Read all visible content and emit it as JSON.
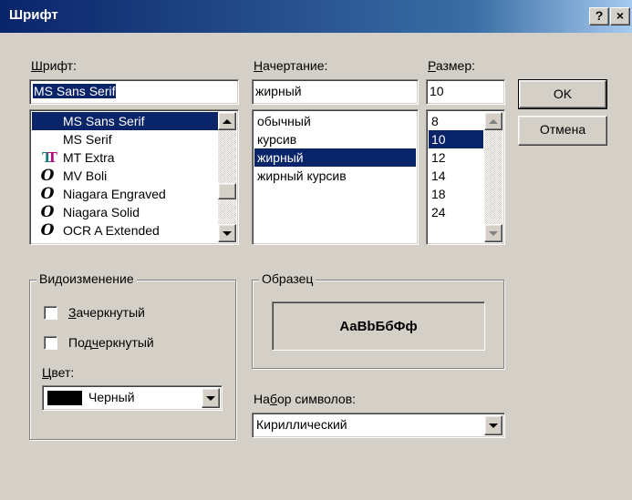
{
  "window": {
    "title": "Шрифт",
    "help_button": "?",
    "close_button": "×"
  },
  "font": {
    "label_prefix": "",
    "label_hotkey": "Ш",
    "label_rest": "рифт:",
    "value": "MS Sans Serif",
    "items": [
      {
        "name": "MS Sans Serif",
        "icon": "none",
        "selected": true
      },
      {
        "name": "MS Serif",
        "icon": "none",
        "selected": false
      },
      {
        "name": "MT Extra",
        "icon": "truetype-icon",
        "selected": false
      },
      {
        "name": "MV Boli",
        "icon": "opentype-icon",
        "selected": false
      },
      {
        "name": "Niagara Engraved",
        "icon": "opentype-icon",
        "selected": false
      },
      {
        "name": "Niagara Solid",
        "icon": "opentype-icon",
        "selected": false
      },
      {
        "name": "OCR A Extended",
        "icon": "opentype-icon",
        "selected": false
      }
    ]
  },
  "style": {
    "label_hotkey": "Н",
    "label_rest": "ачертание:",
    "value": "жирный",
    "items": [
      {
        "name": "обычный",
        "selected": false
      },
      {
        "name": "курсив",
        "selected": false
      },
      {
        "name": "жирный",
        "selected": true
      },
      {
        "name": "жирный курсив",
        "selected": false
      }
    ]
  },
  "size": {
    "label_hotkey": "Р",
    "label_rest": "азмер:",
    "value": "10",
    "items": [
      {
        "name": "8",
        "selected": false
      },
      {
        "name": "10",
        "selected": true
      },
      {
        "name": "12",
        "selected": false
      },
      {
        "name": "14",
        "selected": false
      },
      {
        "name": "18",
        "selected": false
      },
      {
        "name": "24",
        "selected": false
      }
    ]
  },
  "buttons": {
    "ok": "OK",
    "cancel": "Отмена"
  },
  "effects": {
    "title": "Видоизменение",
    "strikeout_hotkey": "З",
    "strikeout_rest": "ачеркнутый",
    "underline_pre": "Под",
    "underline_hotkey": "ч",
    "underline_rest": "еркнутый",
    "color_label_hotkey": "Ц",
    "color_label_rest": "вет:",
    "color_value": "Черный",
    "color_swatch": "#000000"
  },
  "sample": {
    "title": "Образец",
    "text": "AaBbБбФф"
  },
  "charset": {
    "label_pre": "На",
    "label_hotkey": "б",
    "label_rest": "ор символов:",
    "value": "Кириллический"
  },
  "colors": {
    "selection": "#0a246a",
    "face": "#d4d0c8"
  }
}
